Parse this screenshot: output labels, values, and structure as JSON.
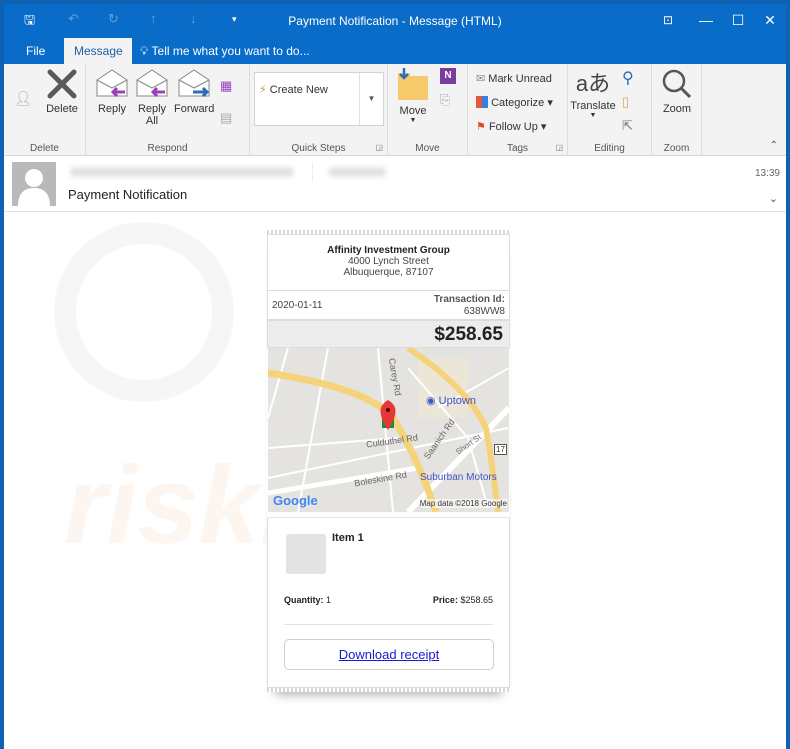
{
  "window": {
    "title": "Payment Notification - Message (HTML)",
    "controls": {
      "restore_ribbon": "⊡",
      "minimize": "—",
      "maximize": "☐",
      "close": "✕"
    }
  },
  "qat": {
    "save": "🖫",
    "undo": "↶",
    "redo": "↻",
    "up": "↑",
    "down": "↓",
    "more": "▾"
  },
  "tabs": {
    "file": "File",
    "message": "Message",
    "tell_me": "Tell me what you want to do..."
  },
  "ribbon": {
    "delete_group": {
      "label": "Delete",
      "delete": "Delete"
    },
    "respond_group": {
      "label": "Respond",
      "reply": "Reply",
      "reply_all_1": "Reply",
      "reply_all_2": "All",
      "forward": "Forward"
    },
    "quick_steps_group": {
      "label": "Quick Steps",
      "create_new": "Create New"
    },
    "move_group": {
      "label": "Move",
      "move": "Move"
    },
    "tags_group": {
      "label": "Tags",
      "mark_unread": "Mark Unread",
      "categorize": "Categorize",
      "follow_up": "Follow Up"
    },
    "editing_group": {
      "label": "Editing",
      "translate": "Translate"
    },
    "zoom_group": {
      "label": "Zoom",
      "zoom": "Zoom"
    }
  },
  "message": {
    "subject": "Payment Notification",
    "time": "13:39"
  },
  "receipt": {
    "company": "Affinity Investment Group",
    "address_line1": "4000 Lynch Street",
    "address_line2": "Albuquerque, 87107",
    "date": "2020-01-11",
    "transaction_label": "Transaction Id:",
    "transaction_id": "638WW8",
    "total": "$258.65",
    "map": {
      "streets": [
        "Carey Rd",
        "Culduthel Rd",
        "Saanich Rd",
        "Short St",
        "Boleskine Rd"
      ],
      "places": [
        "Uptown",
        "Suburban Motors"
      ],
      "route_shield": "17",
      "logo": "Google",
      "attribution": "Map data ©2018 Google"
    },
    "item_name": "Item 1",
    "quantity_label": "Quantity:",
    "quantity": "1",
    "price_label": "Price:",
    "price": "$258.65",
    "download_label": "Download receipt"
  }
}
